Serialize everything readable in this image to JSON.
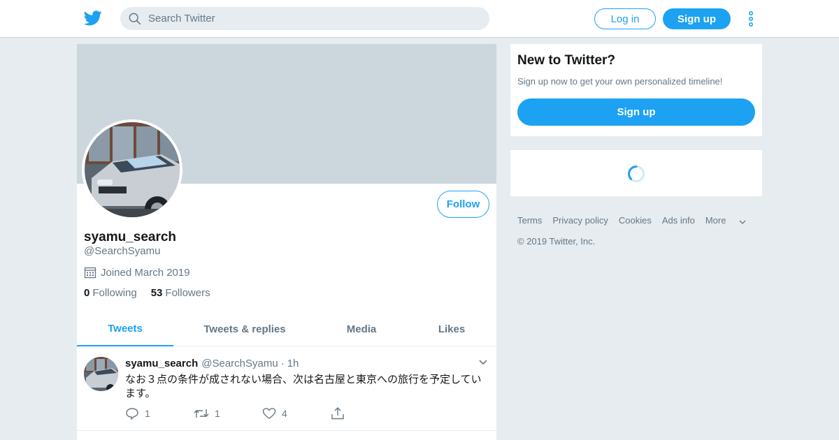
{
  "nav": {
    "search_placeholder": "Search Twitter",
    "login_label": "Log in",
    "signup_label": "Sign up"
  },
  "profile": {
    "follow_label": "Follow",
    "display_name": "syamu_search",
    "handle": "@SearchSyamu",
    "joined": "Joined March 2019",
    "following_count": "0",
    "following_label": "Following",
    "followers_count": "53",
    "followers_label": "Followers"
  },
  "tabs": [
    {
      "label": "Tweets",
      "active": true
    },
    {
      "label": "Tweets & replies",
      "active": false
    },
    {
      "label": "Media",
      "active": false
    },
    {
      "label": "Likes",
      "active": false
    }
  ],
  "tweet": {
    "name": "syamu_search",
    "handle": "@SearchSyamu",
    "separator": "·",
    "time": "1h",
    "text": "なお３点の条件が成されない場合、次は名古屋と東京への旅行を予定しています。",
    "replies": "1",
    "retweets": "1",
    "likes": "4"
  },
  "sidebar": {
    "title": "New to Twitter?",
    "subtitle": "Sign up now to get your own personalized timeline!",
    "signup_label": "Sign up"
  },
  "footer": {
    "links": [
      "Terms",
      "Privacy policy",
      "Cookies",
      "Ads info",
      "More"
    ],
    "copyright": "© 2019 Twitter, Inc."
  },
  "colors": {
    "accent": "#1da1f2",
    "background": "#e6ecf0",
    "banner": "#ccd6dd",
    "muted_text": "#657786"
  }
}
